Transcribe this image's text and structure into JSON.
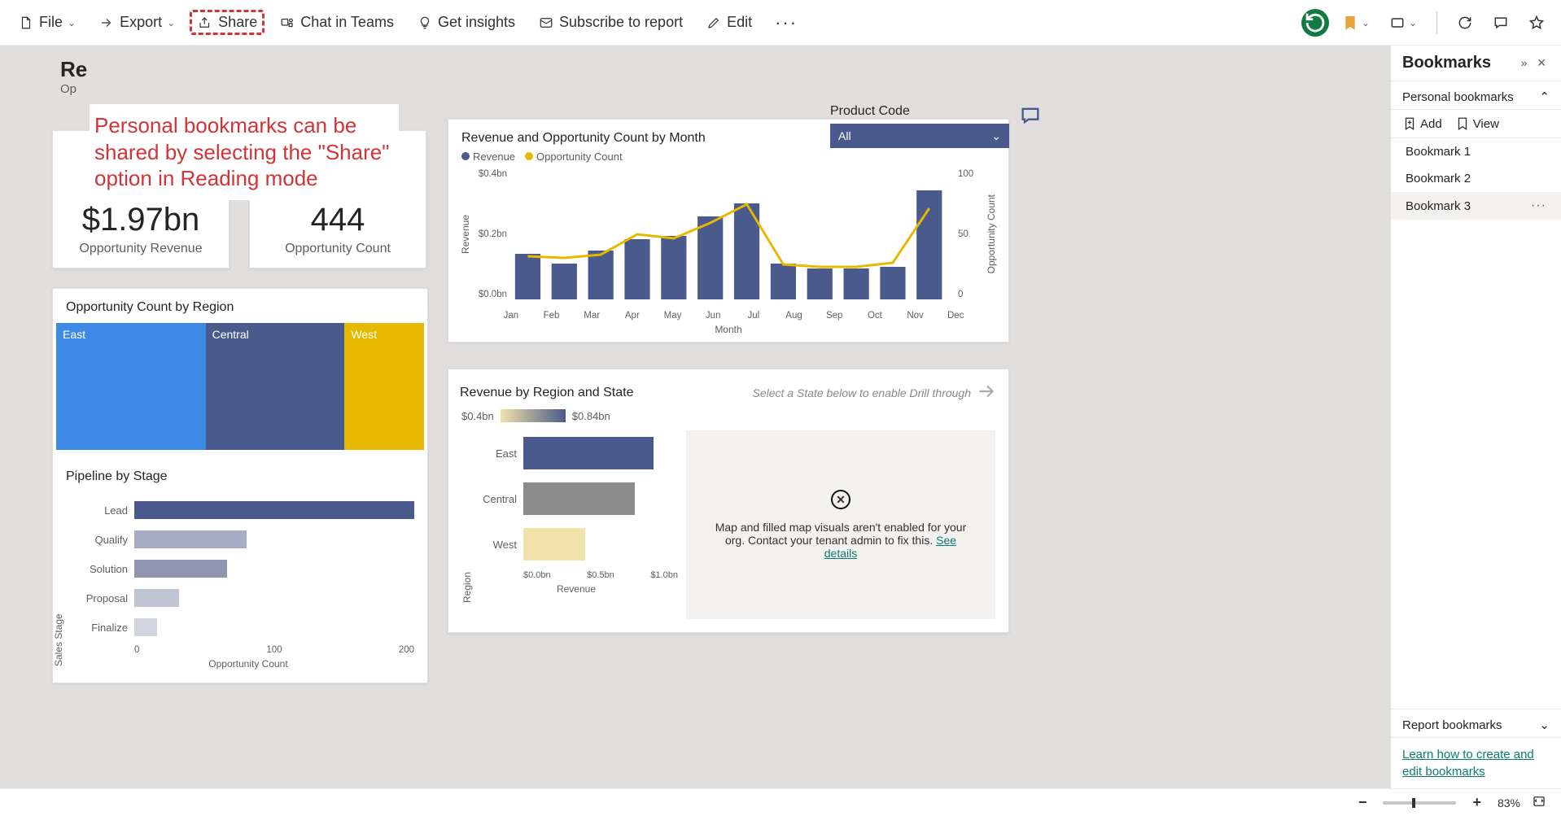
{
  "toolbar": {
    "file": "File",
    "export": "Export",
    "share": "Share",
    "chat": "Chat in Teams",
    "insights": "Get insights",
    "subscribe": "Subscribe to report",
    "edit": "Edit"
  },
  "annotation": "Personal bookmarks can be shared by selecting the \"Share\" option in Reading mode",
  "page": {
    "title_prefix": "Re",
    "subtitle_prefix": "Op"
  },
  "slicer": {
    "label": "Product Code",
    "value": "All"
  },
  "kpi": {
    "revenue_value": "$1.97bn",
    "revenue_label": "Opportunity Revenue",
    "count_value": "444",
    "count_label": "Opportunity Count"
  },
  "treemap": {
    "title": "Opportunity Count by Region",
    "east": "East",
    "central": "Central",
    "west": "West"
  },
  "pipeline": {
    "title": "Pipeline by Stage",
    "xaxis": "Opportunity Count",
    "yaxis": "Sales Stage",
    "ticks": {
      "t0": "0",
      "t1": "100",
      "t2": "200"
    },
    "stages": {
      "lead": "Lead",
      "qualify": "Qualify",
      "solution": "Solution",
      "proposal": "Proposal",
      "finalize": "Finalize"
    }
  },
  "combo": {
    "title": "Revenue and Opportunity Count by Month",
    "legend_rev": "Revenue",
    "legend_cnt": "Opportunity Count",
    "y1_top": "$0.4bn",
    "y1_mid": "$0.2bn",
    "y1_bot": "$0.0bn",
    "y2_top": "100",
    "y2_mid": "50",
    "y2_bot": "0",
    "y1_title": "Revenue",
    "y2_title": "Opportunity Count",
    "x_title": "Month",
    "months": {
      "m0": "Jan",
      "m1": "Feb",
      "m2": "Mar",
      "m3": "Apr",
      "m4": "May",
      "m5": "Jun",
      "m6": "Jul",
      "m7": "Aug",
      "m8": "Sep",
      "m9": "Oct",
      "m10": "Nov",
      "m11": "Dec"
    }
  },
  "regstate": {
    "title": "Revenue by Region and State",
    "hint": "Select a State below to enable Drill through",
    "grad_low": "$0.4bn",
    "grad_high": "$0.84bn",
    "yaxis": "Region",
    "xaxis": "Revenue",
    "ticks": {
      "t0": "$0.0bn",
      "t1": "$0.5bn",
      "t2": "$1.0bn"
    },
    "east": "East",
    "central": "Central",
    "west": "West",
    "map_error": "Map and filled map visuals aren't enabled for your org. Contact your tenant admin to fix this.",
    "map_link": "See details"
  },
  "bookmarks": {
    "title": "Bookmarks",
    "personal": "Personal bookmarks",
    "add": "Add",
    "view": "View",
    "items": {
      "b0": "Bookmark 1",
      "b1": "Bookmark 2",
      "b2": "Bookmark 3"
    },
    "active_index": 2,
    "report_section": "Report bookmarks",
    "help_link": "Learn how to create and edit bookmarks"
  },
  "statusbar": {
    "zoom": "83%"
  },
  "chart_data": [
    {
      "type": "treemap",
      "title": "Opportunity Count by Region",
      "series": [
        {
          "name": "East",
          "value": 39
        },
        {
          "name": "Central",
          "value": 36
        },
        {
          "name": "West",
          "value": 19
        }
      ]
    },
    {
      "type": "bar",
      "orientation": "horizontal",
      "title": "Pipeline by Stage",
      "xlabel": "Opportunity Count",
      "ylabel": "Sales Stage",
      "categories": [
        "Lead",
        "Qualify",
        "Solution",
        "Proposal",
        "Finalize"
      ],
      "values": [
        225,
        90,
        75,
        35,
        19
      ],
      "xlim": [
        0,
        250
      ]
    },
    {
      "type": "combo",
      "title": "Revenue and Opportunity Count by Month",
      "categories": [
        "Jan",
        "Feb",
        "Mar",
        "Apr",
        "May",
        "Jun",
        "Jul",
        "Aug",
        "Sep",
        "Oct",
        "Nov",
        "Dec"
      ],
      "series": [
        {
          "name": "Revenue",
          "type": "bar",
          "axis": "y1",
          "unit": "$bn",
          "values": [
            0.14,
            0.11,
            0.15,
            0.185,
            0.195,
            0.255,
            0.295,
            0.11,
            0.095,
            0.095,
            0.1,
            0.335
          ]
        },
        {
          "name": "Opportunity Count",
          "type": "line",
          "axis": "y2",
          "values": [
            33,
            32,
            34,
            50,
            47,
            59,
            73,
            27,
            25,
            25,
            28,
            70
          ]
        }
      ],
      "y1": {
        "label": "Revenue",
        "range": [
          0,
          0.4
        ],
        "ticks": [
          0,
          0.2,
          0.4
        ]
      },
      "y2": {
        "label": "Opportunity Count",
        "range": [
          0,
          100
        ],
        "ticks": [
          0,
          50,
          100
        ]
      },
      "xlabel": "Month"
    },
    {
      "type": "bar",
      "orientation": "horizontal",
      "title": "Revenue by Region and State",
      "xlabel": "Revenue",
      "ylabel": "Region",
      "categories": [
        "East",
        "Central",
        "West"
      ],
      "values": [
        0.84,
        0.72,
        0.4
      ],
      "unit": "$bn",
      "xlim": [
        0,
        1.0
      ],
      "color_scale": {
        "low": 0.4,
        "high": 0.84
      }
    }
  ]
}
